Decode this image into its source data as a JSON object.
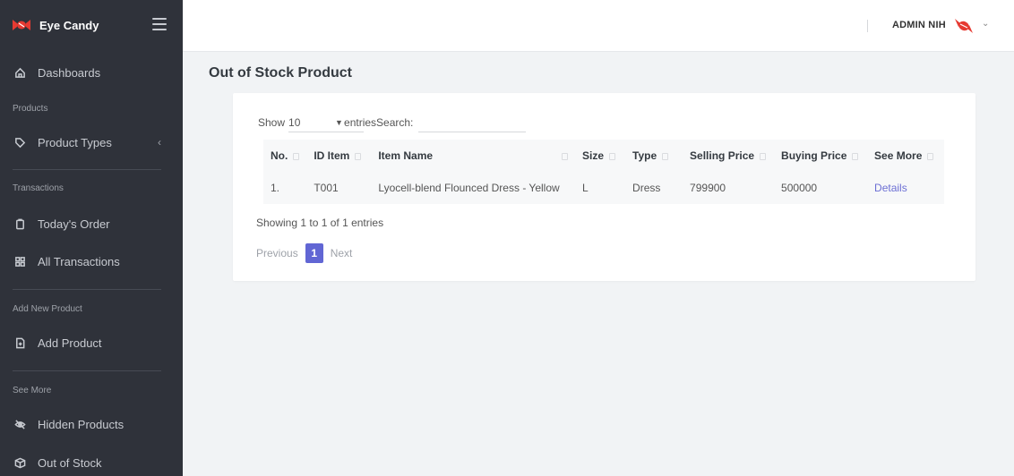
{
  "app": {
    "brand_name": "Eye Candy"
  },
  "sidebar": {
    "items": [
      {
        "label": "Dashboards",
        "icon": "home-icon"
      },
      {
        "label": "Product Types",
        "icon": "tag-icon"
      },
      {
        "label": "Today's Order",
        "icon": "clipboard-icon"
      },
      {
        "label": "All Transactions",
        "icon": "grid-icon"
      },
      {
        "label": "Add Product",
        "icon": "file-plus-icon"
      },
      {
        "label": "Hidden Products",
        "icon": "eye-off-icon"
      },
      {
        "label": "Out of Stock",
        "icon": "box-icon"
      }
    ],
    "sections": [
      "Products",
      "Transactions",
      "Add New Product",
      "See More"
    ]
  },
  "header": {
    "admin_name": "ADMIN NIH"
  },
  "main": {
    "title": "Out of Stock Product",
    "controls": {
      "show_label": "Show",
      "length_value": "10",
      "entries_label": "entries",
      "search_label": "Search:",
      "search_value": ""
    },
    "table": {
      "headers": [
        "No.",
        "ID Item",
        "Item Name",
        "Size",
        "Type",
        "Selling Price",
        "Buying Price",
        "See More"
      ],
      "rows": [
        {
          "no": "1.",
          "id": "T001",
          "name": "Lyocell-blend Flounced Dress - Yellow",
          "size": "L",
          "type": "Dress",
          "selling": "799900",
          "buying": "500000",
          "link": "Details"
        }
      ]
    },
    "info": "Showing 1 to 1 of 1 entries",
    "pagination": {
      "prev": "Previous",
      "current": "1",
      "next": "Next"
    }
  },
  "colors": {
    "sidebar_bg": "#2f323a",
    "accent": "#6166d4",
    "link": "#6c6fd4",
    "brand_logo": "#e63a32"
  }
}
